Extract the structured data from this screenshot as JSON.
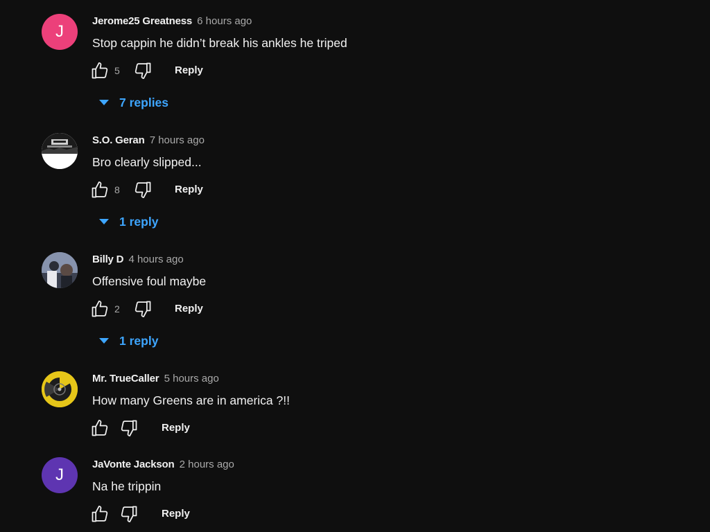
{
  "comments": [
    {
      "author": "Jerome25 Greatness",
      "time": "6 hours ago",
      "text": "Stop cappin he didn’t break his ankles he triped",
      "avatar_letter": "J",
      "avatar_color": "#ec407a",
      "likes": "5",
      "reply_label": "Reply",
      "replies_label": "7 replies"
    },
    {
      "author": "S.O. Geran",
      "time": "7 hours ago",
      "text": "Bro clearly slipped...",
      "avatar_letter": "",
      "avatar_color": "#ffffff",
      "likes": "8",
      "reply_label": "Reply",
      "replies_label": "1 reply"
    },
    {
      "author": "Billy D",
      "time": "4 hours ago",
      "text": "Offensive foul maybe",
      "avatar_letter": "",
      "avatar_color": "#6b7a99",
      "likes": "2",
      "reply_label": "Reply",
      "replies_label": "1 reply"
    },
    {
      "author": "Mr. TrueCaller",
      "time": "5 hours ago",
      "text": "How many Greens are in america ?!!",
      "avatar_letter": "",
      "avatar_color": "#e6c619",
      "likes": "",
      "reply_label": "Reply",
      "replies_label": ""
    },
    {
      "author": "JaVonte Jackson",
      "time": "2 hours ago",
      "text": "Na he trippin",
      "avatar_letter": "J",
      "avatar_color": "#5e35b1",
      "likes": "",
      "reply_label": "Reply",
      "replies_label": ""
    }
  ],
  "colors": {
    "background": "#0f0f0f",
    "link": "#3ea6ff",
    "secondary_text": "#aaaaaa",
    "primary_text": "#f1f1f1"
  },
  "icons": [
    "thumb-up-icon",
    "thumb-down-icon",
    "caret-down-icon"
  ]
}
